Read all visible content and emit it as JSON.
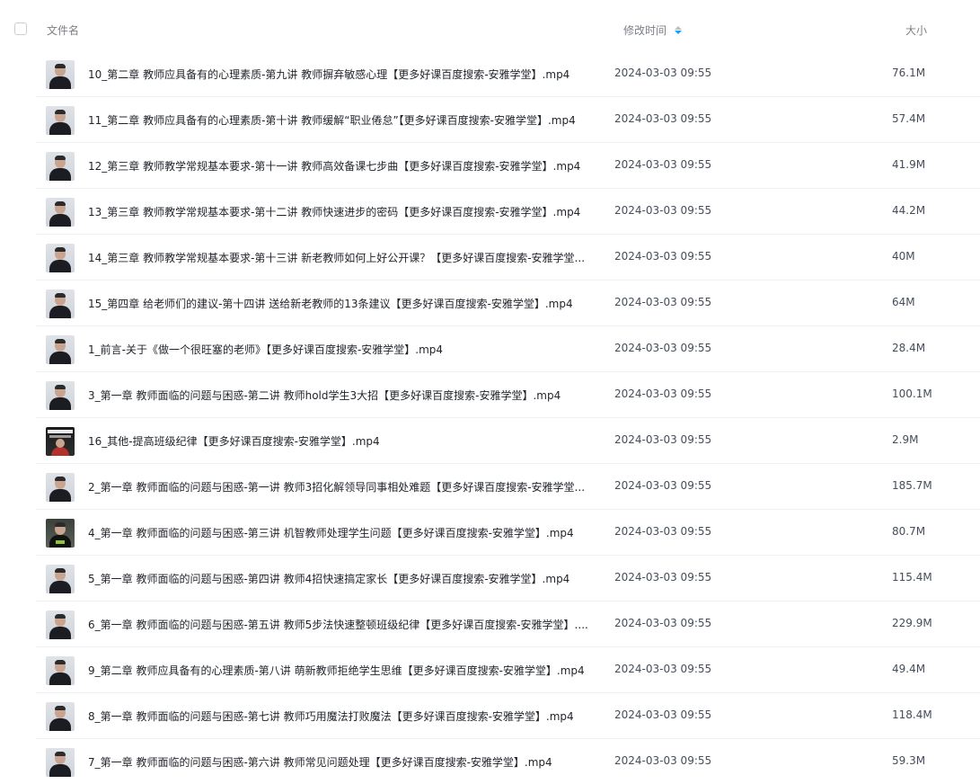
{
  "header": {
    "name_label": "文件名",
    "time_label": "修改时间",
    "size_label": "大小",
    "sort_icon": "sort-desc-icon",
    "accent_color": "#06a7ff"
  },
  "files": [
    {
      "name": "10_第二章 教师应具备有的心理素质-第九讲 教师摒弃敏感心理【更多好课百度搜索-安雅学堂】.mp4",
      "time": "2024-03-03 09:55",
      "size": "76.1M",
      "thumb": "person"
    },
    {
      "name": "11_第二章 教师应具备有的心理素质-第十讲 教师缓解“职业倦怠”【更多好课百度搜索-安雅学堂】.mp4",
      "time": "2024-03-03 09:55",
      "size": "57.4M",
      "thumb": "person"
    },
    {
      "name": "12_第三章 教师教学常规基本要求-第十一讲 教师高效备课七步曲【更多好课百度搜索-安雅学堂】.mp4",
      "time": "2024-03-03 09:55",
      "size": "41.9M",
      "thumb": "person"
    },
    {
      "name": "13_第三章 教师教学常规基本要求-第十二讲 教师快速进步的密码【更多好课百度搜索-安雅学堂】.mp4",
      "time": "2024-03-03 09:55",
      "size": "44.2M",
      "thumb": "person"
    },
    {
      "name": "14_第三章 教师教学常规基本要求-第十三讲 新老教师如何上好公开课？【更多好课百度搜索-安雅学堂...",
      "time": "2024-03-03 09:55",
      "size": "40M",
      "thumb": "person"
    },
    {
      "name": "15_第四章 给老师们的建议-第十四讲 送给新老教师的13条建议【更多好课百度搜索-安雅学堂】.mp4",
      "time": "2024-03-03 09:55",
      "size": "64M",
      "thumb": "person"
    },
    {
      "name": "1_前言-关于《做一个很旺塞的老师》【更多好课百度搜索-安雅学堂】.mp4",
      "time": "2024-03-03 09:55",
      "size": "28.4M",
      "thumb": "person"
    },
    {
      "name": "3_第一章 教师面临的问题与困惑-第二讲 教师hold学生3大招【更多好课百度搜索-安雅学堂】.mp4",
      "time": "2024-03-03 09:55",
      "size": "100.1M",
      "thumb": "person"
    },
    {
      "name": "16_其他-提高班级纪律【更多好课百度搜索-安雅学堂】.mp4",
      "time": "2024-03-03 09:55",
      "size": "2.9M",
      "thumb": "promo"
    },
    {
      "name": "2_第一章 教师面临的问题与困惑-第一讲 教师3招化解领导同事相处难题【更多好课百度搜索-安雅学堂...",
      "time": "2024-03-03 09:55",
      "size": "185.7M",
      "thumb": "person"
    },
    {
      "name": "4_第一章 教师面临的问题与困惑-第三讲 机智教师处理学生问题【更多好课百度搜索-安雅学堂】.mp4",
      "time": "2024-03-03 09:55",
      "size": "80.7M",
      "thumb": "dark"
    },
    {
      "name": "5_第一章 教师面临的问题与困惑-第四讲 教师4招快速搞定家长【更多好课百度搜索-安雅学堂】.mp4",
      "time": "2024-03-03 09:55",
      "size": "115.4M",
      "thumb": "person"
    },
    {
      "name": "6_第一章 教师面临的问题与困惑-第五讲 教师5步法快速整顿班级纪律【更多好课百度搜索-安雅学堂】....",
      "time": "2024-03-03 09:55",
      "size": "229.9M",
      "thumb": "person"
    },
    {
      "name": "9_第二章 教师应具备有的心理素质-第八讲 萌新教师拒绝学生思维【更多好课百度搜索-安雅学堂】.mp4",
      "time": "2024-03-03 09:55",
      "size": "49.4M",
      "thumb": "person"
    },
    {
      "name": "8_第一章 教师面临的问题与困惑-第七讲 教师巧用魔法打败魔法【更多好课百度搜索-安雅学堂】.mp4",
      "time": "2024-03-03 09:55",
      "size": "118.4M",
      "thumb": "person"
    },
    {
      "name": "7_第一章 教师面临的问题与困惑-第六讲 教师常见问题处理【更多好课百度搜索-安雅学堂】.mp4",
      "time": "2024-03-03 09:55",
      "size": "59.3M",
      "thumb": "person"
    }
  ]
}
